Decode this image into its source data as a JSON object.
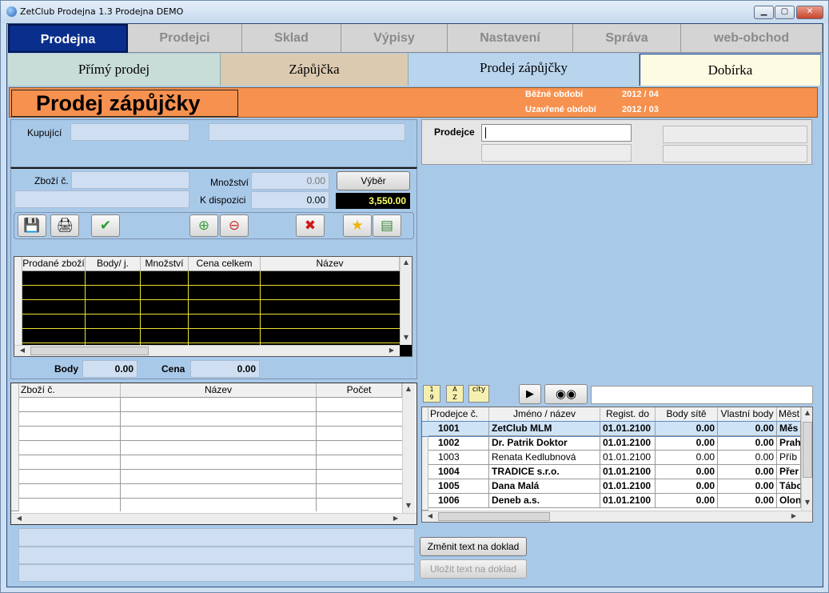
{
  "window": {
    "title": "ZetClub Prodejna 1.3  Prodejna DEMO"
  },
  "main_tabs": [
    {
      "label": "Prodejna"
    },
    {
      "label": "Prodejci"
    },
    {
      "label": "Sklad"
    },
    {
      "label": "Výpisy"
    },
    {
      "label": "Nastavení"
    },
    {
      "label": "Správa"
    },
    {
      "label": "web-obchod"
    }
  ],
  "sub_tabs": [
    {
      "label": "Přímý prodej",
      "color": "#c8ddd8"
    },
    {
      "label": "Zápůjčka",
      "color": "#dccab0"
    },
    {
      "label": "Prodej zápůjčky",
      "color": "#b9d5ee"
    },
    {
      "label": "Dobírka",
      "color": "#fdfbe2"
    }
  ],
  "banner": {
    "title": "Prodej zápůjčky",
    "current_period_label": "Běžné období",
    "current_period_value": "2012 / 04",
    "closed_period_label": "Uzavřené období",
    "closed_period_value": "2012 / 03"
  },
  "buyer": {
    "label": "Kupující"
  },
  "seller": {
    "label": "Prodejce",
    "value": ""
  },
  "item": {
    "label": "Zboží č.",
    "quantity_label": "Množství",
    "quantity_value": "0.00",
    "available_label": "K dispozici",
    "available_value": "0.00",
    "select_button": "Výběr",
    "price_display": "3,550.00"
  },
  "toolbar": {
    "icons": [
      "save-icon",
      "print-icon",
      "check-icon",
      "add-icon",
      "remove-icon",
      "delete-icon",
      "star-icon",
      "money-icon"
    ]
  },
  "sold_grid": {
    "columns": [
      "Prodané zboží",
      "Body/ j.",
      "Množství",
      "Cena celkem",
      "Název"
    ]
  },
  "totals": {
    "points_label": "Body",
    "points_value": "0.00",
    "price_label": "Cena",
    "price_value": "0.00"
  },
  "stock_grid": {
    "columns": [
      "Zboží č.",
      "Název",
      "Počet"
    ]
  },
  "seller_grid": {
    "columns": [
      "Prodejce č.",
      "Jméno / název",
      "Regist. do",
      "Body sítě",
      "Vlastní body",
      "Měst"
    ],
    "rows": [
      {
        "id": "1001",
        "name": "ZetClub MLM",
        "reg": "01.01.2100",
        "net": "0.00",
        "own": "0.00",
        "city": "Měs",
        "bold": true,
        "selected": true
      },
      {
        "id": "1002",
        "name": "Dr. Patrik  Doktor",
        "reg": "01.01.2100",
        "net": "0.00",
        "own": "0.00",
        "city": "Prah",
        "bold": true
      },
      {
        "id": "1003",
        "name": "Renata  Kedlubnová",
        "reg": "01.01.2100",
        "net": "0.00",
        "own": "0.00",
        "city": "Příb",
        "bold": false
      },
      {
        "id": "1004",
        "name": "TRADICE s.r.o.",
        "reg": "01.01.2100",
        "net": "0.00",
        "own": "0.00",
        "city": "Přer",
        "bold": true
      },
      {
        "id": "1005",
        "name": "Dana  Malá",
        "reg": "01.01.2100",
        "net": "0.00",
        "own": "0.00",
        "city": "Tábo",
        "bold": true
      },
      {
        "id": "1006",
        "name": "Deneb a.s.",
        "reg": "01.01.2100",
        "net": "0.00",
        "own": "0.00",
        "city": "Olon",
        "bold": true
      }
    ]
  },
  "sort_buttons": {
    "city": "city"
  },
  "actions": {
    "change_text": "Změnit text na doklad",
    "save_text": "Uložit text na doklad"
  },
  "colors": {
    "accent": "#0a2e8c",
    "banner": "#f7914f",
    "background": "#a9c9e9",
    "price_text": "#ffff66"
  }
}
